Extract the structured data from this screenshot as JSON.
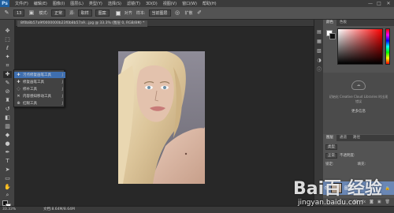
{
  "menubar": {
    "logo": "Ps",
    "items": [
      "文件(F)",
      "编辑(E)",
      "图像(I)",
      "图层(L)",
      "类型(Y)",
      "选择(S)",
      "滤镜(T)",
      "3D(D)",
      "视图(V)",
      "窗口(W)",
      "帮助(H)"
    ],
    "min": "—",
    "max": "□",
    "close": "✕"
  },
  "optbar": {
    "brush_size": "13",
    "mode_label": "模式:",
    "mode_value": "正常",
    "source_label": "源:",
    "sampled": "取样",
    "pattern": "图案",
    "aligned": "对齐",
    "sample_label": "样本:",
    "sample_value": "当前图层",
    "diffusion": "扩散"
  },
  "doctab": {
    "title": "8f0b8b57a9f0000000b23f0b8b57a9...jpg @ 33.3% (图层 0, RGB/8#) *",
    "close": "×"
  },
  "flyout": {
    "items": [
      {
        "label": "污点修复画笔工具",
        "key": "J"
      },
      {
        "label": "修复画笔工具",
        "key": "J"
      },
      {
        "label": "修补工具",
        "key": "J"
      },
      {
        "label": "内容感知移动工具",
        "key": "J"
      },
      {
        "label": "红眼工具",
        "key": "J"
      }
    ]
  },
  "color_panel": {
    "tabs": [
      "颜色",
      "色板"
    ],
    "colors": {
      "fg": "#ffffff",
      "bg": "#000000",
      "accent": "#ff0000"
    }
  },
  "libraries": {
    "text": "初始化 Creative Cloud Libraries 时出现错误",
    "button": "更多信息"
  },
  "layers_panel": {
    "tabs": [
      "图层",
      "通道",
      "路径"
    ],
    "kind_label": "类型",
    "blend_mode": "正常",
    "opacity_label": "不透明度:",
    "lock_label": "锁定:",
    "fill_label": "填充:",
    "layer_name": "图层 0"
  },
  "statusbar": {
    "zoom": "33.33%",
    "doc": "文档:8.64M/8.64M"
  },
  "watermark": {
    "brand": "Bai百 经验",
    "url": "jingyan.baidu.com"
  }
}
